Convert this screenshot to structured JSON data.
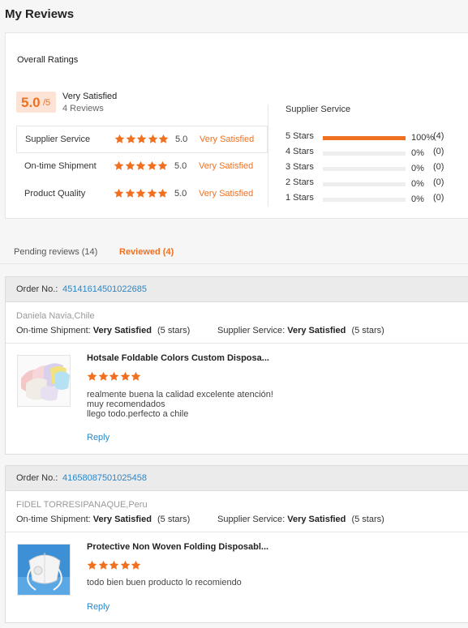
{
  "page": {
    "title": "My Reviews"
  },
  "overall": {
    "title": "Overall Ratings",
    "score": "5.0",
    "score_max": "/5",
    "score_text": "Very Satisfied",
    "review_count": "4 Reviews",
    "metrics": [
      {
        "name": "Supplier Service",
        "stars": 5,
        "score": "5.0",
        "label": "Very Satisfied"
      },
      {
        "name": "On-time Shipment",
        "stars": 5,
        "score": "5.0",
        "label": "Very Satisfied"
      },
      {
        "name": "Product Quality",
        "stars": 5,
        "score": "5.0",
        "label": "Very Satisfied"
      }
    ],
    "distribution_title": "Supplier Service",
    "distribution": [
      {
        "label": "5  Stars",
        "fraction": 1.0,
        "percent": "100%",
        "count": "(4)"
      },
      {
        "label": "4  Stars",
        "fraction": 0,
        "percent": "0%",
        "count": "(0)"
      },
      {
        "label": "3  Stars",
        "fraction": 0,
        "percent": "0%",
        "count": "(0)"
      },
      {
        "label": "2  Stars",
        "fraction": 0,
        "percent": "0%",
        "count": "(0)"
      },
      {
        "label": "1  Stars",
        "fraction": 0,
        "percent": "0%",
        "count": "(0)"
      }
    ]
  },
  "tabs": {
    "pending": "Pending reviews (14)",
    "reviewed": "Reviewed (4)"
  },
  "orders": [
    {
      "order_label": "Order No.:",
      "order_no": "45141614501022685",
      "buyer": "Daniela Navia,Chile",
      "shipment_label": "On-time Shipment:",
      "shipment_value": "Very Satisfied",
      "shipment_stars": "(5 stars)",
      "service_label": "Supplier Service:",
      "service_value": "Very Satisfied",
      "service_stars": "(5 stars)",
      "product_title": "Hotsale Foldable Colors Custom Disposa...",
      "product_rating": 5,
      "review_lines": [
        "realmente buena la calidad excelente atención!",
        "muy recomendados",
        "llego todo.perfecto a chile"
      ],
      "reply": "Reply"
    },
    {
      "order_label": "Order No.:",
      "order_no": "41658087501025458",
      "buyer": "FIDEL TORRESIPANAQUE,Peru",
      "shipment_label": "On-time Shipment:",
      "shipment_value": "Very Satisfied",
      "shipment_stars": "(5 stars)",
      "service_label": "Supplier Service:",
      "service_value": "Very Satisfied",
      "service_stars": "(5 stars)",
      "product_title": "Protective Non Woven Folding Disposabl...",
      "product_rating": 5,
      "review_lines": [
        "todo bien buen producto lo recomiendo"
      ],
      "reply": "Reply"
    }
  ],
  "colors": {
    "accent": "#f07020",
    "link": "#2a86c8"
  }
}
